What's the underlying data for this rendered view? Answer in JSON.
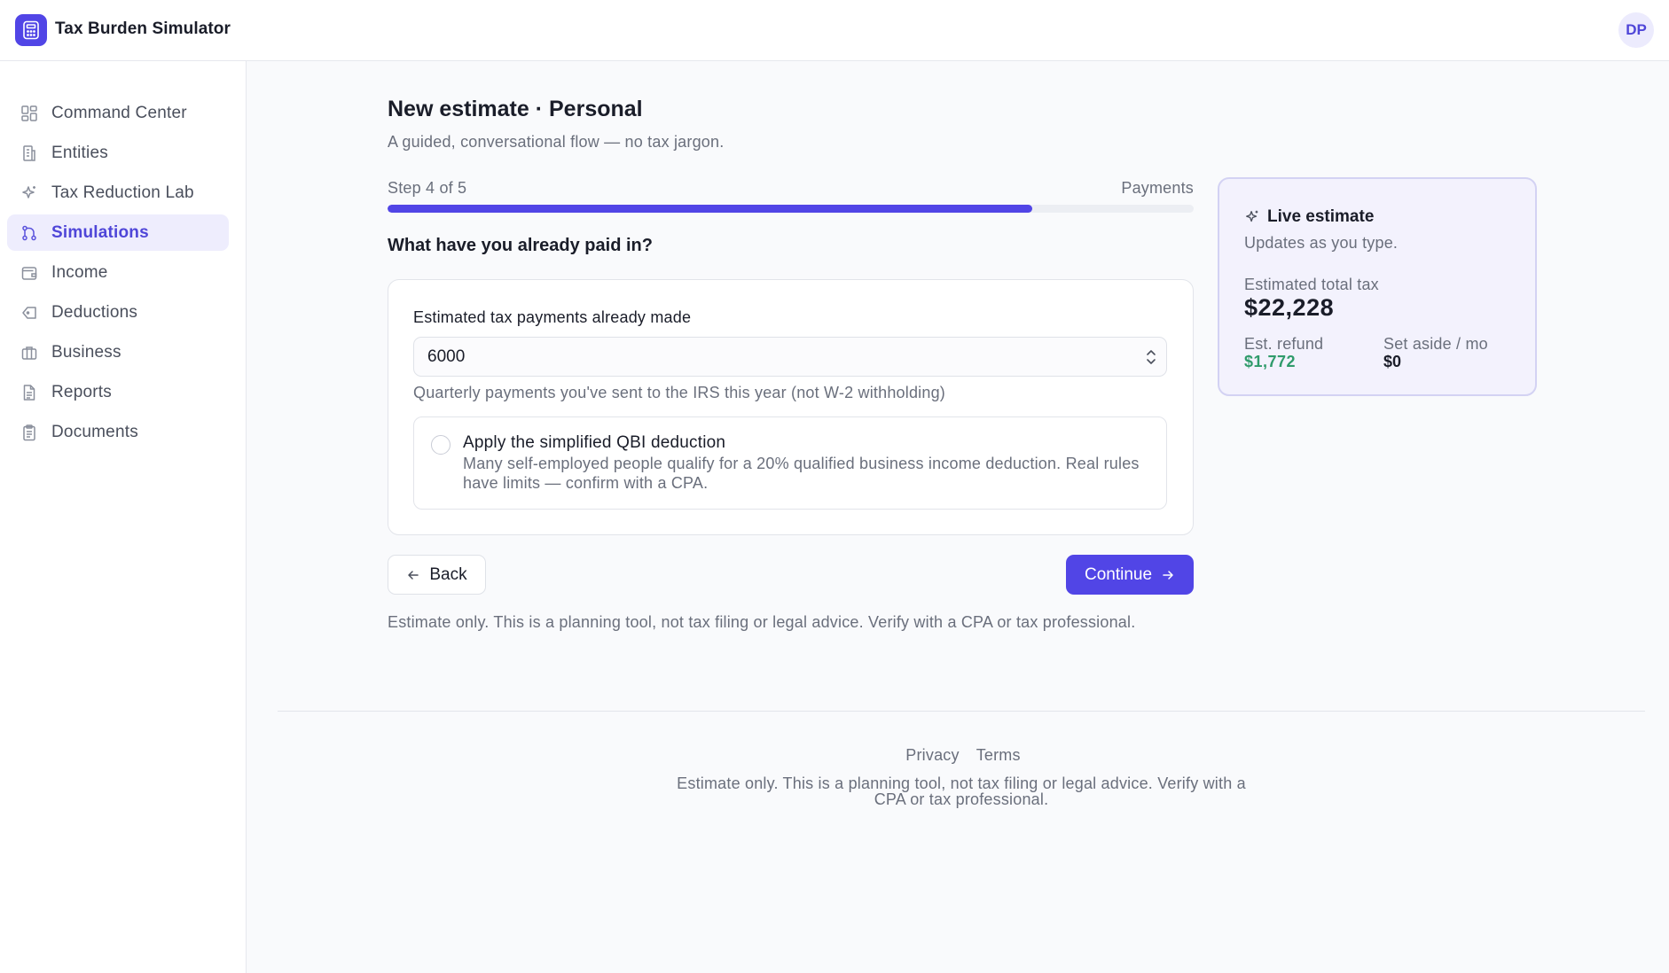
{
  "app": {
    "title": "Tax Burden Simulator",
    "avatar_initials": "DP",
    "accent_color": "#5145e6"
  },
  "sidebar": {
    "items": [
      {
        "label": "Command Center",
        "icon": "dashboard-icon",
        "active": false
      },
      {
        "label": "Entities",
        "icon": "building-icon",
        "active": false
      },
      {
        "label": "Tax Reduction Lab",
        "icon": "sparkle-icon",
        "active": false
      },
      {
        "label": "Simulations",
        "icon": "branch-icon",
        "active": true
      },
      {
        "label": "Income",
        "icon": "wallet-icon",
        "active": false
      },
      {
        "label": "Deductions",
        "icon": "tag-icon",
        "active": false
      },
      {
        "label": "Business",
        "icon": "briefcase-icon",
        "active": false
      },
      {
        "label": "Reports",
        "icon": "file-icon",
        "active": false
      },
      {
        "label": "Documents",
        "icon": "clipboard-icon",
        "active": false
      }
    ]
  },
  "main": {
    "title": "New estimate · Personal",
    "subtitle": "A guided, conversational flow — no tax jargon.",
    "step_label": "Step 4 of 5",
    "step_name": "Payments",
    "progress_fraction": 0.8,
    "question": "What have you already paid in?",
    "field_label": "Estimated tax payments already made",
    "field_value": "6000",
    "field_help": "Quarterly payments you've sent to the IRS this year (not W-2 withholding)",
    "qbi_title": "Apply the simplified QBI deduction",
    "qbi_desc": "Many self-employed people qualify for a 20% qualified business income deduction. Real rules have limits — confirm with a CPA.",
    "qbi_checked": false,
    "back_label": "Back",
    "continue_label": "Continue",
    "disclaimer": "Estimate only. This is a planning tool, not tax filing or legal advice. Verify with a CPA or tax professional."
  },
  "live_estimate": {
    "title": "Live estimate",
    "subtitle": "Updates as you type.",
    "total_label": "Estimated total tax",
    "total_value": "$22,228",
    "refund_label": "Est. refund",
    "refund_value": "$1,772",
    "aside_label": "Set aside / mo",
    "aside_value": "$0",
    "refund_color": "#2f9b6b"
  },
  "footer": {
    "privacy": "Privacy",
    "terms": "Terms",
    "note": "Estimate only. This is a planning tool, not tax filing or legal advice. Verify with a CPA or tax professional."
  }
}
